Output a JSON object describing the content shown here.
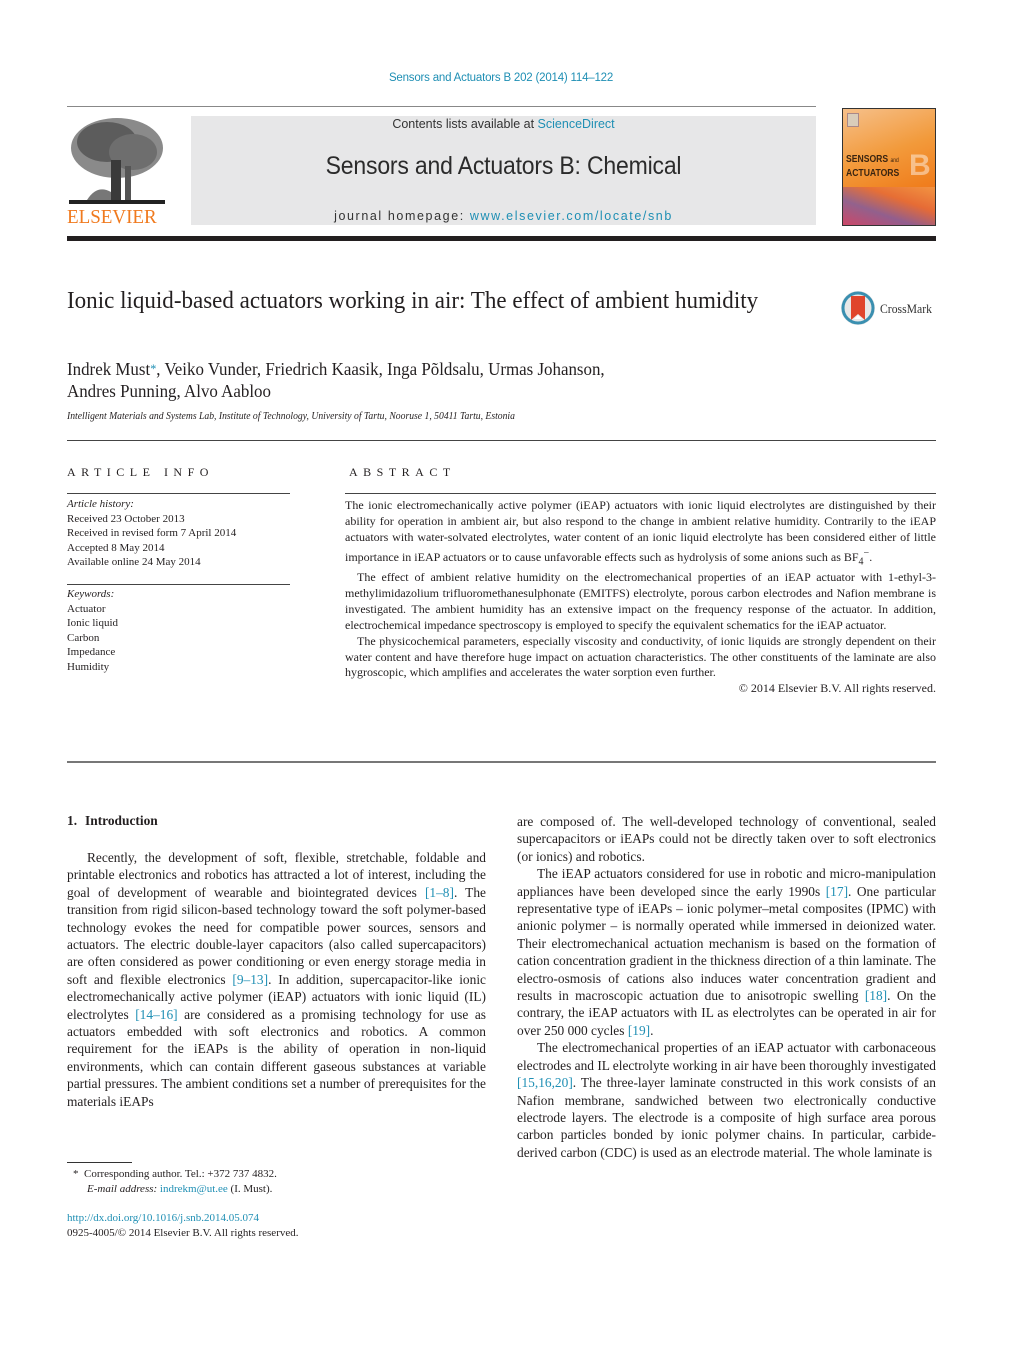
{
  "header": {
    "journal_ref": "Sensors and Actuators B 202 (2014) 114–122",
    "contents_prefix": "Contents lists available at ",
    "contents_link": "ScienceDirect",
    "journal_name": "Sensors and Actuators B: Chemical",
    "homepage_prefix": "journal homepage: ",
    "homepage_link": "www.elsevier.com/locate/snb",
    "publisher_logo_text": "ELSEVIER",
    "cover": {
      "title_line1": "SENSORS",
      "title_and": "and",
      "title_line2": "ACTUATORS",
      "letter": "B"
    },
    "accent_color": "#1f8fb4",
    "logo_color": "#f07a1e"
  },
  "article": {
    "title": "Ionic liquid-based actuators working in air: The effect of ambient humidity",
    "crossmark_label": "CrossMark",
    "authors_first": "Indrek Must",
    "corresponding_marker": "*",
    "authors_rest_line1": ", Veiko Vunder, Friedrich Kaasik, Inga Põldsalu, Urmas Johanson,",
    "authors_line2": "Andres Punning, Alvo Aabloo",
    "affiliation": "Intelligent Materials and Systems Lab, Institute of Technology, University of Tartu, Nooruse 1, 50411 Tartu, Estonia"
  },
  "article_info": {
    "heading": "ARTICLE INFO",
    "history_label": "Article history:",
    "history": [
      "Received 23 October 2013",
      "Received in revised form 7 April 2014",
      "Accepted 8 May 2014",
      "Available online 24 May 2014"
    ],
    "keywords_label": "Keywords:",
    "keywords": [
      "Actuator",
      "Ionic liquid",
      "Carbon",
      "Impedance",
      "Humidity"
    ]
  },
  "abstract": {
    "heading": "ABSTRACT",
    "p1": "The ionic electromechanically active polymer (iEAP) actuators with ionic liquid electrolytes are distinguished by their ability for operation in ambient air, but also respond to the change in ambient relative humidity. Contrarily to the iEAP actuators with water-solvated electrolytes, water content of an ionic liquid electrolyte has been considered either of little importance in iEAP actuators or to cause unfavorable effects such as hydrolysis of some anions such as BF",
    "p1_sub": "4",
    "p1_sup": "−",
    "p1_end": ".",
    "p2": "The effect of ambient relative humidity on the electromechanical properties of an iEAP actuator with 1-ethyl-3-methylimidazolium trifluoromethanesulphonate (EMITFS) electrolyte, porous carbon electrodes and Nafion membrane is investigated. The ambient humidity has an extensive impact on the frequency response of the actuator. In addition, electrochemical impedance spectroscopy is employed to specify the equivalent schematics for the iEAP actuator.",
    "p3": "The physicochemical parameters, especially viscosity and conductivity, of ionic liquids are strongly dependent on their water content and have therefore huge impact on actuation characteristics. The other constituents of the laminate are also hygroscopic, which amplifies and accelerates the water sorption even further.",
    "copyright": "© 2014 Elsevier B.V. All rights reserved."
  },
  "introduction": {
    "number": "1.",
    "heading": "Introduction",
    "left": {
      "s1": "Recently, the development of soft, flexible, stretchable, foldable and printable electronics and robotics has attracted a lot of interest, including the goal of development of wearable and biointegrated devices ",
      "r1": "[1–8]",
      "s2": ". The transition from rigid silicon-based technology toward the soft polymer-based technology evokes the need for compatible power sources, sensors and actuators. The electric double-layer capacitors (also called supercapacitors) are often considered as power conditioning or even energy storage media in soft and flexible electronics ",
      "r2": "[9–13]",
      "s3": ". In addition, supercapacitor-like ionic electromechanically active polymer (iEAP) actuators with ionic liquid (IL) electrolytes ",
      "r3": "[14–16]",
      "s4": " are considered as a promising technology for use as actuators embedded with soft electronics and robotics. A common requirement for the iEAPs is the ability of operation in non-liquid environments, which can contain different gaseous substances at variable partial pressures. The ambient conditions set a number of prerequisites for the materials iEAPs"
    },
    "right": {
      "p1": "are composed of. The well-developed technology of conventional, sealed supercapacitors or iEAPs could not be directly taken over to soft electronics (or ionics) and robotics.",
      "p2_s1": "The iEAP actuators considered for use in robotic and micro-manipulation appliances have been developed since the early 1990s ",
      "p2_r1": "[17]",
      "p2_s2": ". One particular representative type of iEAPs – ionic polymer–metal composites (IPMC) with anionic polymer – is normally operated while immersed in deionized water. Their electromechanical actuation mechanism is based on the formation of cation concentration gradient in the thickness direction of a thin laminate. The electro-osmosis of cations also induces water concentration gradient and results in macroscopic actuation due to anisotropic swelling ",
      "p2_r2": "[18]",
      "p2_s3": ". On the contrary, the iEAP actuators with IL as electrolytes can be operated in air for over 250 000 cycles ",
      "p2_r3": "[19]",
      "p2_s4": ".",
      "p3_s1": "The electromechanical properties of an iEAP actuator with carbonaceous electrodes and IL electrolyte working in air have been thoroughly investigated ",
      "p3_r1": "[15,16,20]",
      "p3_s2": ". The three-layer laminate constructed in this work consists of an Nafion membrane, sandwiched between two electronically conductive electrode layers. The electrode is a composite of high surface area porous carbon particles bonded by ionic polymer chains. In particular, carbide-derived carbon (CDC) is used as an electrode material. The whole laminate is"
    }
  },
  "footer": {
    "fn_marker": "*",
    "fn_corresponding": "Corresponding author. Tel.: +372 737 4832.",
    "fn_email_label": "E-mail address: ",
    "fn_email": "indrekm@ut.ee",
    "fn_email_suffix": " (I. Must).",
    "doi": "http://dx.doi.org/10.1016/j.snb.2014.05.074",
    "issn_copyright": "0925-4005/© 2014 Elsevier B.V. All rights reserved."
  }
}
